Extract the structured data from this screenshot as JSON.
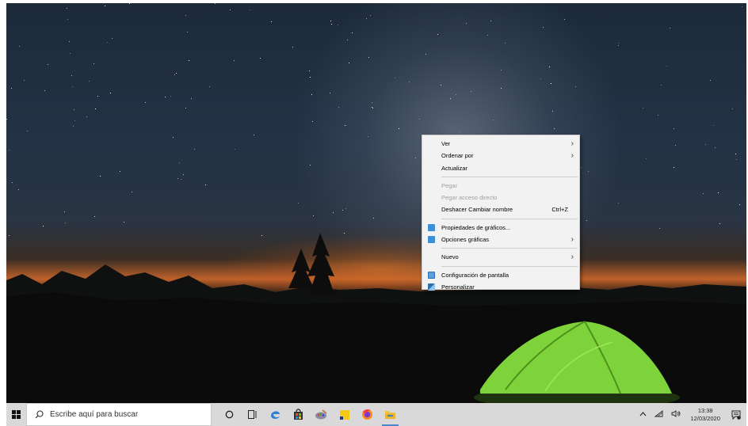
{
  "context_menu": {
    "items": [
      {
        "label": "Ver",
        "submenu": true
      },
      {
        "label": "Ordenar por",
        "submenu": true
      },
      {
        "label": "Actualizar"
      },
      {
        "label": "Pegar",
        "disabled": true
      },
      {
        "label": "Pegar acceso directo",
        "disabled": true
      },
      {
        "label": "Deshacer Cambiar nombre",
        "accelerator": "Ctrl+Z"
      },
      {
        "label": "Propiedades de gráficos...",
        "icon": "graphics-icon"
      },
      {
        "label": "Opciones gráficas",
        "icon": "graphics-icon",
        "submenu": true
      },
      {
        "label": "Nuevo",
        "submenu": true
      },
      {
        "label": "Configuración de pantalla",
        "icon": "display-icon"
      },
      {
        "label": "Personalizar",
        "icon": "personalize-icon"
      }
    ]
  },
  "taskbar": {
    "search_placeholder": "Escribe aquí para buscar",
    "apps": [
      "cortana-icon",
      "task-view-icon",
      "edge-icon",
      "store-icon",
      "paint-icon",
      "sticky-notes-icon",
      "firefox-icon",
      "file-explorer-icon"
    ],
    "clock_time": "13:38",
    "clock_date": "12/03/2020"
  },
  "colors": {
    "taskbar_bg": "#d9d9d9",
    "menu_bg": "#f2f2f2",
    "accent": "#4a86c8",
    "tent_green": "#7ed33a"
  }
}
